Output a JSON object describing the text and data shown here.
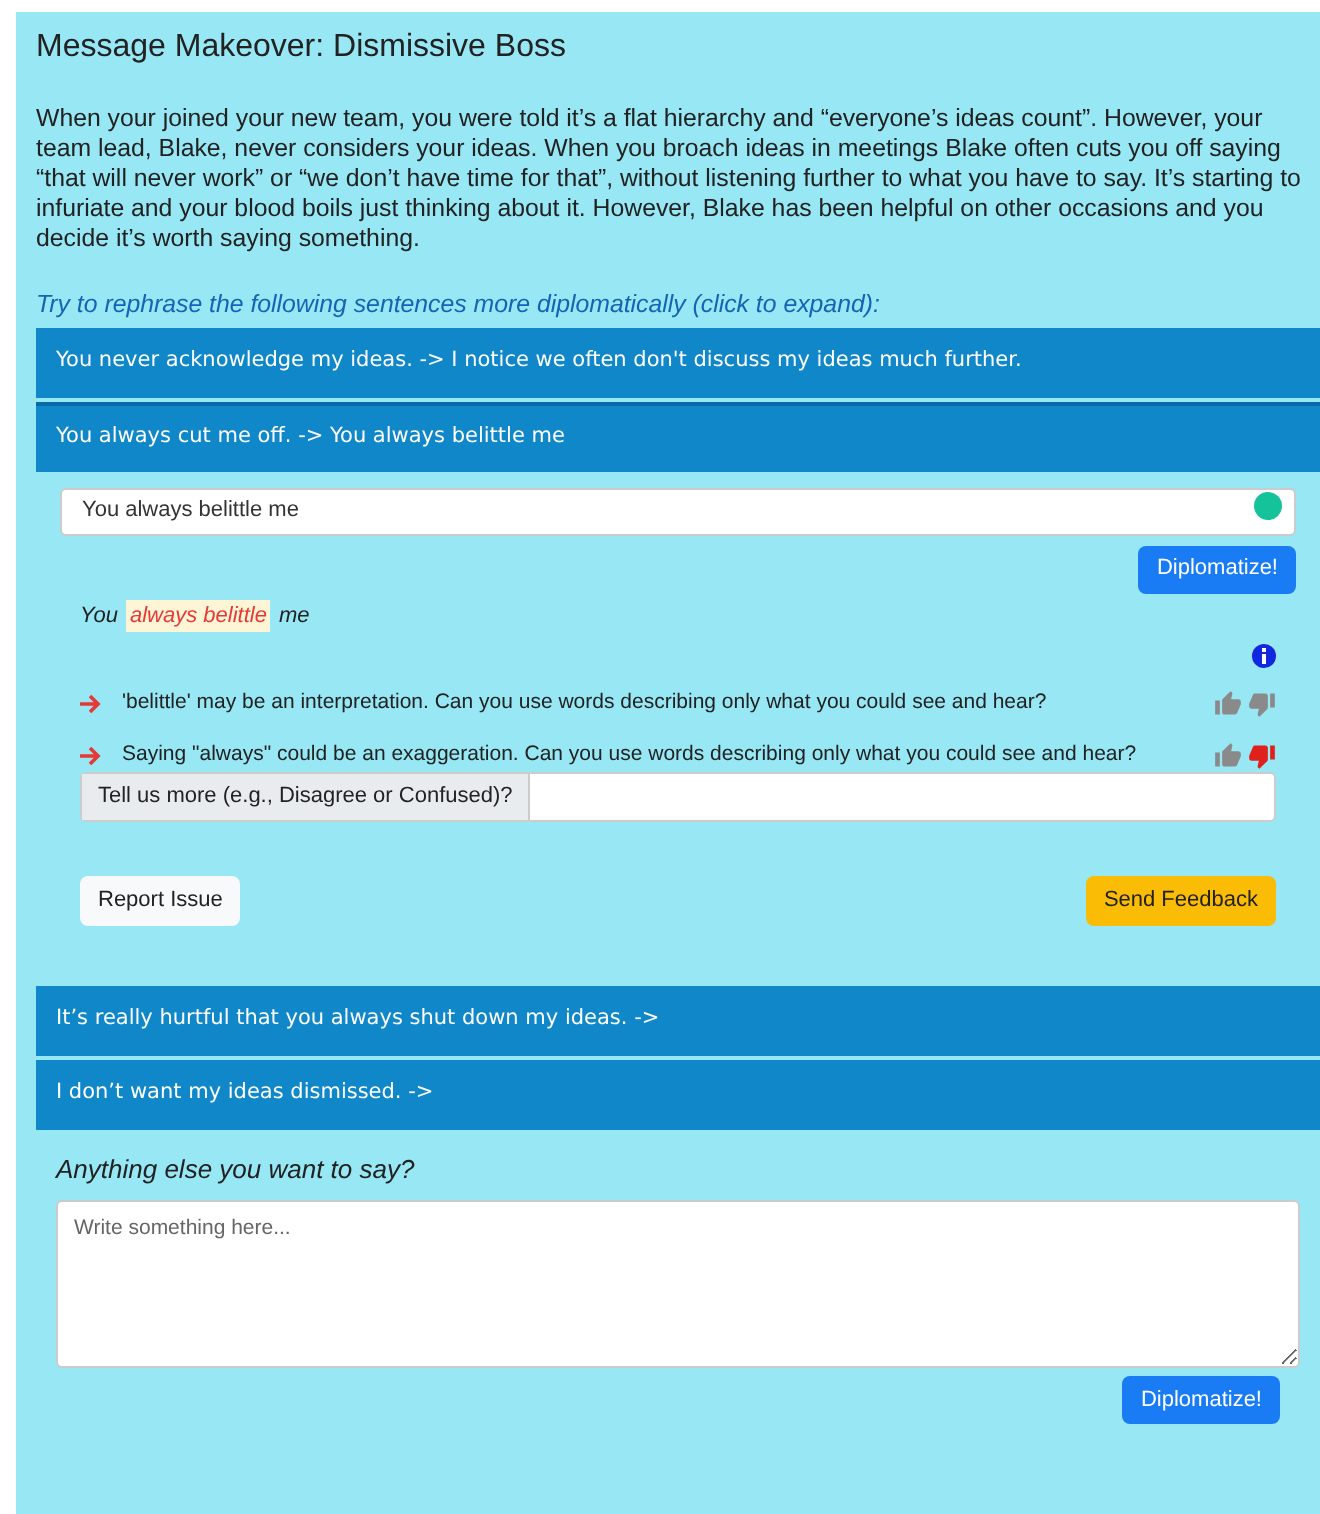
{
  "title": "Message Makeover: Dismissive Boss",
  "scenario": "When your joined your new team, you were told it’s a flat hierarchy and “everyone’s ideas count”. However, your team lead, Blake, never considers your ideas. When you broach ideas in meetings Blake often cuts you off saying “that will never work” or “we don’t have time for that”, without listening further to what you have to say. It’s starting to infuriate and your blood boils just thinking about it. However, Blake has been helpful on other occasions and you decide it’s worth saying something.",
  "instructions": "Try to rephrase the following sentences more diplomatically (click to expand):",
  "items": [
    {
      "label": "You never acknowledge my ideas. -> I notice we often don't discuss my ideas much further.",
      "expanded": false
    },
    {
      "label": "You always cut me off. -> You always belittle me",
      "expanded": true,
      "detail": {
        "rephrase_value": "You always belittle me",
        "diplomatize_button": "Diplomatize!",
        "analysis": [
          {
            "text": "You",
            "highlighted": false
          },
          {
            "text": "always belittle",
            "highlighted": true
          },
          {
            "text": "me",
            "highlighted": false
          }
        ],
        "suggestions": [
          {
            "text": "'belittle' may be an interpretation. Can you use words describing only what you could see and hear?",
            "thumbs_up": false,
            "thumbs_down": false
          },
          {
            "text": "Saying \"always\" could be an exaggeration. Can you use words describing only what you could see and hear?",
            "thumbs_up": false,
            "thumbs_down": true
          }
        ],
        "tell_more_label": "Tell us more (e.g., Disagree or Confused)?",
        "report_button": "Report Issue",
        "send_button": "Send Feedback"
      }
    },
    {
      "label": "It’s really hurtful that you always shut down my ideas. ->",
      "expanded": false
    },
    {
      "label": "I don’t want my ideas dismissed. ->",
      "expanded": false
    }
  ],
  "other": {
    "prompt": "Anything else you want to say?",
    "placeholder": "Write something here...",
    "button": "Diplomatize!"
  }
}
